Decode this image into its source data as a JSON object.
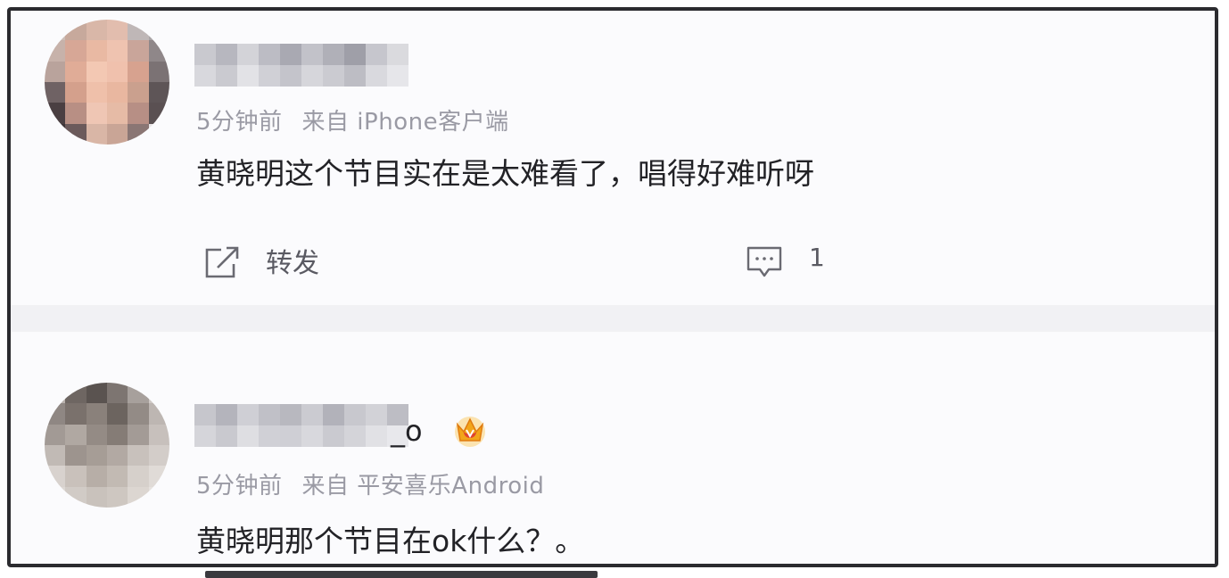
{
  "comments": [
    {
      "meta_time": "5分钟前",
      "meta_source": "来自 iPhone客户端",
      "text": "黄晓明这个节目实在是太难看了，唱得好难听呀",
      "repost_label": "转发",
      "comment_count": "1"
    },
    {
      "name_suffix": "_o",
      "meta_time": "5分钟前",
      "meta_source": "来自 平安喜乐Android",
      "text": "黄晓明那个节目在ok什么？。"
    }
  ],
  "colors": {
    "frame_border": "#2b2b2f",
    "muted_text": "#9a9aa4",
    "body_text": "#222226",
    "crown": "#f2a51a"
  },
  "icons": [
    "repost-icon",
    "comment-icon",
    "vip-crown-icon"
  ]
}
